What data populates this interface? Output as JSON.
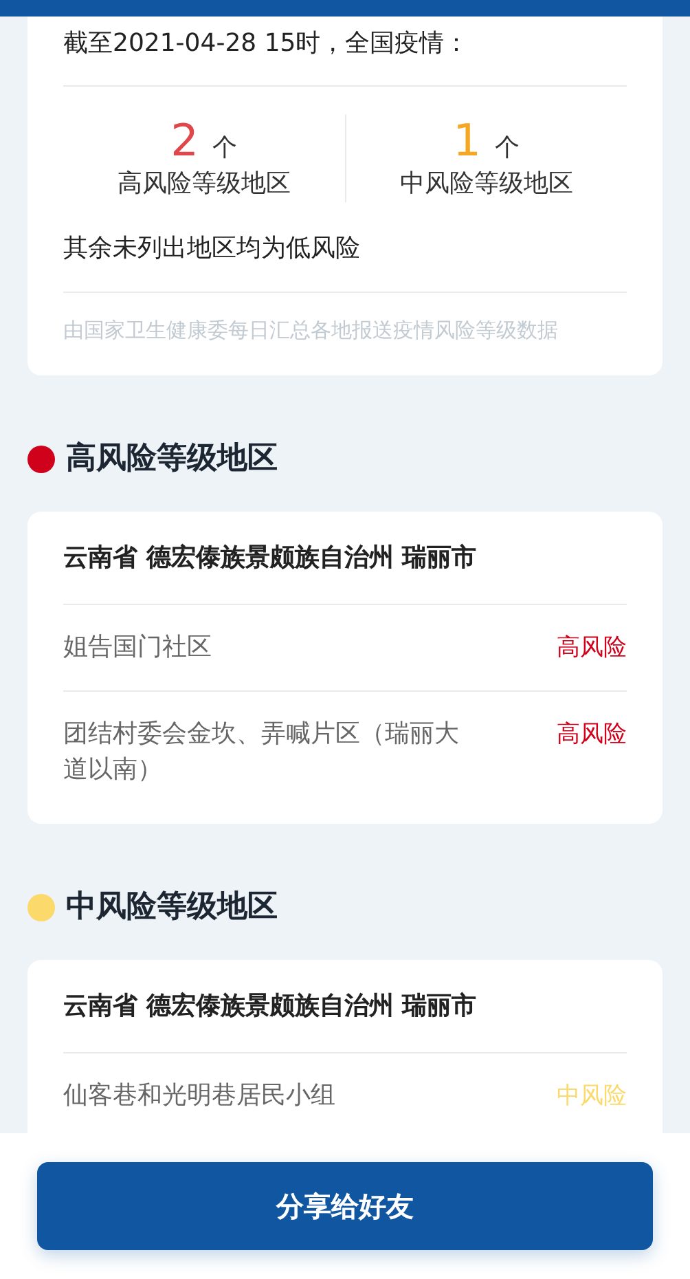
{
  "summary": {
    "as_of": "截至2021-04-28 15时，全国疫情：",
    "counts": [
      {
        "number": "2",
        "unit": "个",
        "label": "高风险等级地区",
        "color": "#e0474c"
      },
      {
        "number": "1",
        "unit": "个",
        "label": "中风险等级地区",
        "color": "#f5a623"
      }
    ],
    "note": "其余未列出地区均为低风险",
    "source": "由国家卫生健康委每日汇总各地报送疫情风险等级数据"
  },
  "sections": [
    {
      "title": "高风险等级地区",
      "color": "#d0021b",
      "groups": [
        {
          "location": "云南省 德宏傣族景颇族自治州 瑞丽市",
          "areas": [
            {
              "name": "姐告国门社区",
              "level_label": "高风险"
            },
            {
              "name": "团结村委会金坎、弄喊片区（瑞丽大道以南）",
              "level_label": "高风险"
            }
          ]
        }
      ]
    },
    {
      "title": "中风险等级地区",
      "color": "#fbd96b",
      "groups": [
        {
          "location": "云南省 德宏傣族景颇族自治州 瑞丽市",
          "areas": [
            {
              "name": "仙客巷和光明巷居民小组",
              "level_label": "中风险"
            }
          ]
        }
      ]
    }
  ],
  "share_button": "分享给好友"
}
